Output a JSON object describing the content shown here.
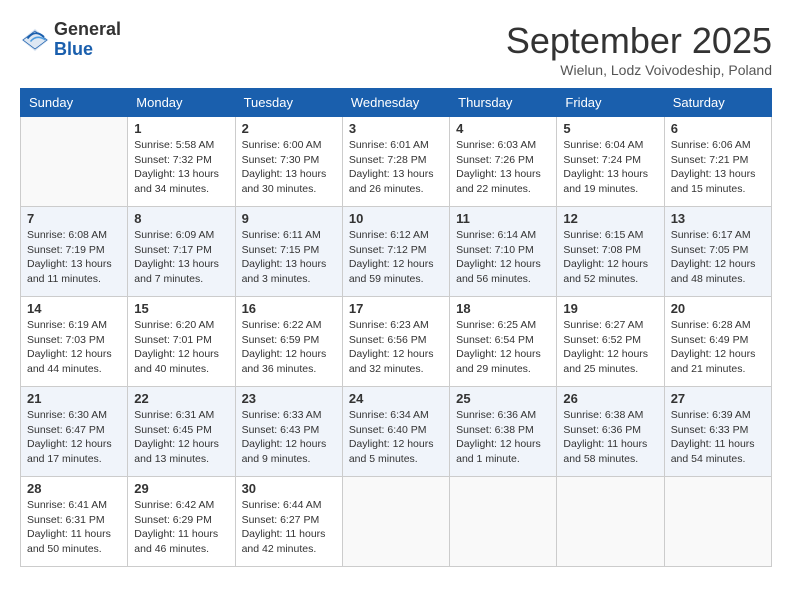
{
  "logo": {
    "general": "General",
    "blue": "Blue"
  },
  "header": {
    "month": "September 2025",
    "location": "Wielun, Lodz Voivodeship, Poland"
  },
  "weekdays": [
    "Sunday",
    "Monday",
    "Tuesday",
    "Wednesday",
    "Thursday",
    "Friday",
    "Saturday"
  ],
  "weeks": [
    [
      {
        "day": "",
        "sunrise": "",
        "sunset": "",
        "daylight": ""
      },
      {
        "day": "1",
        "sunrise": "Sunrise: 5:58 AM",
        "sunset": "Sunset: 7:32 PM",
        "daylight": "Daylight: 13 hours and 34 minutes."
      },
      {
        "day": "2",
        "sunrise": "Sunrise: 6:00 AM",
        "sunset": "Sunset: 7:30 PM",
        "daylight": "Daylight: 13 hours and 30 minutes."
      },
      {
        "day": "3",
        "sunrise": "Sunrise: 6:01 AM",
        "sunset": "Sunset: 7:28 PM",
        "daylight": "Daylight: 13 hours and 26 minutes."
      },
      {
        "day": "4",
        "sunrise": "Sunrise: 6:03 AM",
        "sunset": "Sunset: 7:26 PM",
        "daylight": "Daylight: 13 hours and 22 minutes."
      },
      {
        "day": "5",
        "sunrise": "Sunrise: 6:04 AM",
        "sunset": "Sunset: 7:24 PM",
        "daylight": "Daylight: 13 hours and 19 minutes."
      },
      {
        "day": "6",
        "sunrise": "Sunrise: 6:06 AM",
        "sunset": "Sunset: 7:21 PM",
        "daylight": "Daylight: 13 hours and 15 minutes."
      }
    ],
    [
      {
        "day": "7",
        "sunrise": "Sunrise: 6:08 AM",
        "sunset": "Sunset: 7:19 PM",
        "daylight": "Daylight: 13 hours and 11 minutes."
      },
      {
        "day": "8",
        "sunrise": "Sunrise: 6:09 AM",
        "sunset": "Sunset: 7:17 PM",
        "daylight": "Daylight: 13 hours and 7 minutes."
      },
      {
        "day": "9",
        "sunrise": "Sunrise: 6:11 AM",
        "sunset": "Sunset: 7:15 PM",
        "daylight": "Daylight: 13 hours and 3 minutes."
      },
      {
        "day": "10",
        "sunrise": "Sunrise: 6:12 AM",
        "sunset": "Sunset: 7:12 PM",
        "daylight": "Daylight: 12 hours and 59 minutes."
      },
      {
        "day": "11",
        "sunrise": "Sunrise: 6:14 AM",
        "sunset": "Sunset: 7:10 PM",
        "daylight": "Daylight: 12 hours and 56 minutes."
      },
      {
        "day": "12",
        "sunrise": "Sunrise: 6:15 AM",
        "sunset": "Sunset: 7:08 PM",
        "daylight": "Daylight: 12 hours and 52 minutes."
      },
      {
        "day": "13",
        "sunrise": "Sunrise: 6:17 AM",
        "sunset": "Sunset: 7:05 PM",
        "daylight": "Daylight: 12 hours and 48 minutes."
      }
    ],
    [
      {
        "day": "14",
        "sunrise": "Sunrise: 6:19 AM",
        "sunset": "Sunset: 7:03 PM",
        "daylight": "Daylight: 12 hours and 44 minutes."
      },
      {
        "day": "15",
        "sunrise": "Sunrise: 6:20 AM",
        "sunset": "Sunset: 7:01 PM",
        "daylight": "Daylight: 12 hours and 40 minutes."
      },
      {
        "day": "16",
        "sunrise": "Sunrise: 6:22 AM",
        "sunset": "Sunset: 6:59 PM",
        "daylight": "Daylight: 12 hours and 36 minutes."
      },
      {
        "day": "17",
        "sunrise": "Sunrise: 6:23 AM",
        "sunset": "Sunset: 6:56 PM",
        "daylight": "Daylight: 12 hours and 32 minutes."
      },
      {
        "day": "18",
        "sunrise": "Sunrise: 6:25 AM",
        "sunset": "Sunset: 6:54 PM",
        "daylight": "Daylight: 12 hours and 29 minutes."
      },
      {
        "day": "19",
        "sunrise": "Sunrise: 6:27 AM",
        "sunset": "Sunset: 6:52 PM",
        "daylight": "Daylight: 12 hours and 25 minutes."
      },
      {
        "day": "20",
        "sunrise": "Sunrise: 6:28 AM",
        "sunset": "Sunset: 6:49 PM",
        "daylight": "Daylight: 12 hours and 21 minutes."
      }
    ],
    [
      {
        "day": "21",
        "sunrise": "Sunrise: 6:30 AM",
        "sunset": "Sunset: 6:47 PM",
        "daylight": "Daylight: 12 hours and 17 minutes."
      },
      {
        "day": "22",
        "sunrise": "Sunrise: 6:31 AM",
        "sunset": "Sunset: 6:45 PM",
        "daylight": "Daylight: 12 hours and 13 minutes."
      },
      {
        "day": "23",
        "sunrise": "Sunrise: 6:33 AM",
        "sunset": "Sunset: 6:43 PM",
        "daylight": "Daylight: 12 hours and 9 minutes."
      },
      {
        "day": "24",
        "sunrise": "Sunrise: 6:34 AM",
        "sunset": "Sunset: 6:40 PM",
        "daylight": "Daylight: 12 hours and 5 minutes."
      },
      {
        "day": "25",
        "sunrise": "Sunrise: 6:36 AM",
        "sunset": "Sunset: 6:38 PM",
        "daylight": "Daylight: 12 hours and 1 minute."
      },
      {
        "day": "26",
        "sunrise": "Sunrise: 6:38 AM",
        "sunset": "Sunset: 6:36 PM",
        "daylight": "Daylight: 11 hours and 58 minutes."
      },
      {
        "day": "27",
        "sunrise": "Sunrise: 6:39 AM",
        "sunset": "Sunset: 6:33 PM",
        "daylight": "Daylight: 11 hours and 54 minutes."
      }
    ],
    [
      {
        "day": "28",
        "sunrise": "Sunrise: 6:41 AM",
        "sunset": "Sunset: 6:31 PM",
        "daylight": "Daylight: 11 hours and 50 minutes."
      },
      {
        "day": "29",
        "sunrise": "Sunrise: 6:42 AM",
        "sunset": "Sunset: 6:29 PM",
        "daylight": "Daylight: 11 hours and 46 minutes."
      },
      {
        "day": "30",
        "sunrise": "Sunrise: 6:44 AM",
        "sunset": "Sunset: 6:27 PM",
        "daylight": "Daylight: 11 hours and 42 minutes."
      },
      {
        "day": "",
        "sunrise": "",
        "sunset": "",
        "daylight": ""
      },
      {
        "day": "",
        "sunrise": "",
        "sunset": "",
        "daylight": ""
      },
      {
        "day": "",
        "sunrise": "",
        "sunset": "",
        "daylight": ""
      },
      {
        "day": "",
        "sunrise": "",
        "sunset": "",
        "daylight": ""
      }
    ]
  ]
}
